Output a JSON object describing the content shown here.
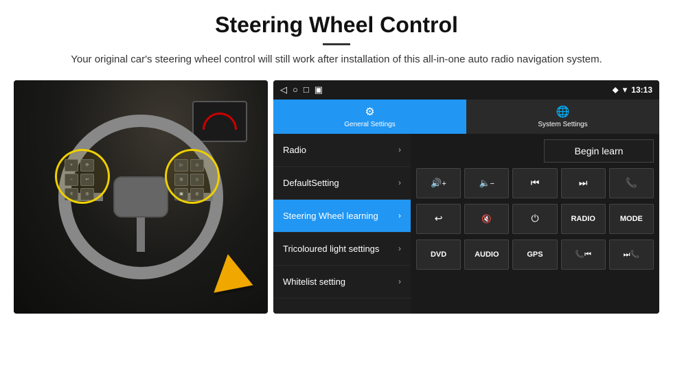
{
  "header": {
    "title": "Steering Wheel Control",
    "divider": true,
    "subtitle": "Your original car's steering wheel control will still work after installation of this all-in-one auto radio navigation system."
  },
  "statusBar": {
    "icons": [
      "◁",
      "○",
      "□",
      "▣"
    ],
    "rightIcons": [
      "⬥",
      "▾"
    ],
    "time": "13:13"
  },
  "tabs": [
    {
      "id": "general",
      "icon": "⚙",
      "label": "General Settings",
      "active": true
    },
    {
      "id": "system",
      "icon": "🌐",
      "label": "System Settings",
      "active": false
    }
  ],
  "menuItems": [
    {
      "id": "radio",
      "label": "Radio",
      "active": false
    },
    {
      "id": "default",
      "label": "DefaultSetting",
      "active": false
    },
    {
      "id": "steering",
      "label": "Steering Wheel learning",
      "active": true
    },
    {
      "id": "tricolour",
      "label": "Tricoloured light settings",
      "active": false
    },
    {
      "id": "whitelist",
      "label": "Whitelist setting",
      "active": false
    }
  ],
  "beginLearnLabel": "Begin learn",
  "controlButtons": {
    "row1": [
      {
        "id": "vol-up",
        "symbol": "🔊+",
        "type": "icon"
      },
      {
        "id": "vol-down",
        "symbol": "🔇-",
        "type": "icon"
      },
      {
        "id": "prev-track",
        "symbol": "⏮",
        "type": "icon"
      },
      {
        "id": "next-track",
        "symbol": "⏭",
        "type": "icon"
      },
      {
        "id": "phone",
        "symbol": "📞",
        "type": "icon"
      }
    ],
    "row2": [
      {
        "id": "hang-up",
        "symbol": "📵",
        "type": "icon"
      },
      {
        "id": "mute",
        "symbol": "🔇×",
        "type": "icon"
      },
      {
        "id": "power",
        "symbol": "⏻",
        "type": "icon"
      },
      {
        "id": "radio-btn",
        "label": "RADIO",
        "type": "text"
      },
      {
        "id": "mode-btn",
        "label": "MODE",
        "type": "text"
      }
    ],
    "row3": [
      {
        "id": "dvd-btn",
        "label": "DVD",
        "type": "text"
      },
      {
        "id": "audio-btn",
        "label": "AUDIO",
        "type": "text"
      },
      {
        "id": "gps-btn",
        "label": "GPS",
        "type": "text"
      },
      {
        "id": "tel-prev",
        "symbol": "📞⏮",
        "type": "icon"
      },
      {
        "id": "tel-next",
        "symbol": "⏭📞",
        "type": "icon"
      }
    ]
  },
  "whitelistIcon": "🎵"
}
